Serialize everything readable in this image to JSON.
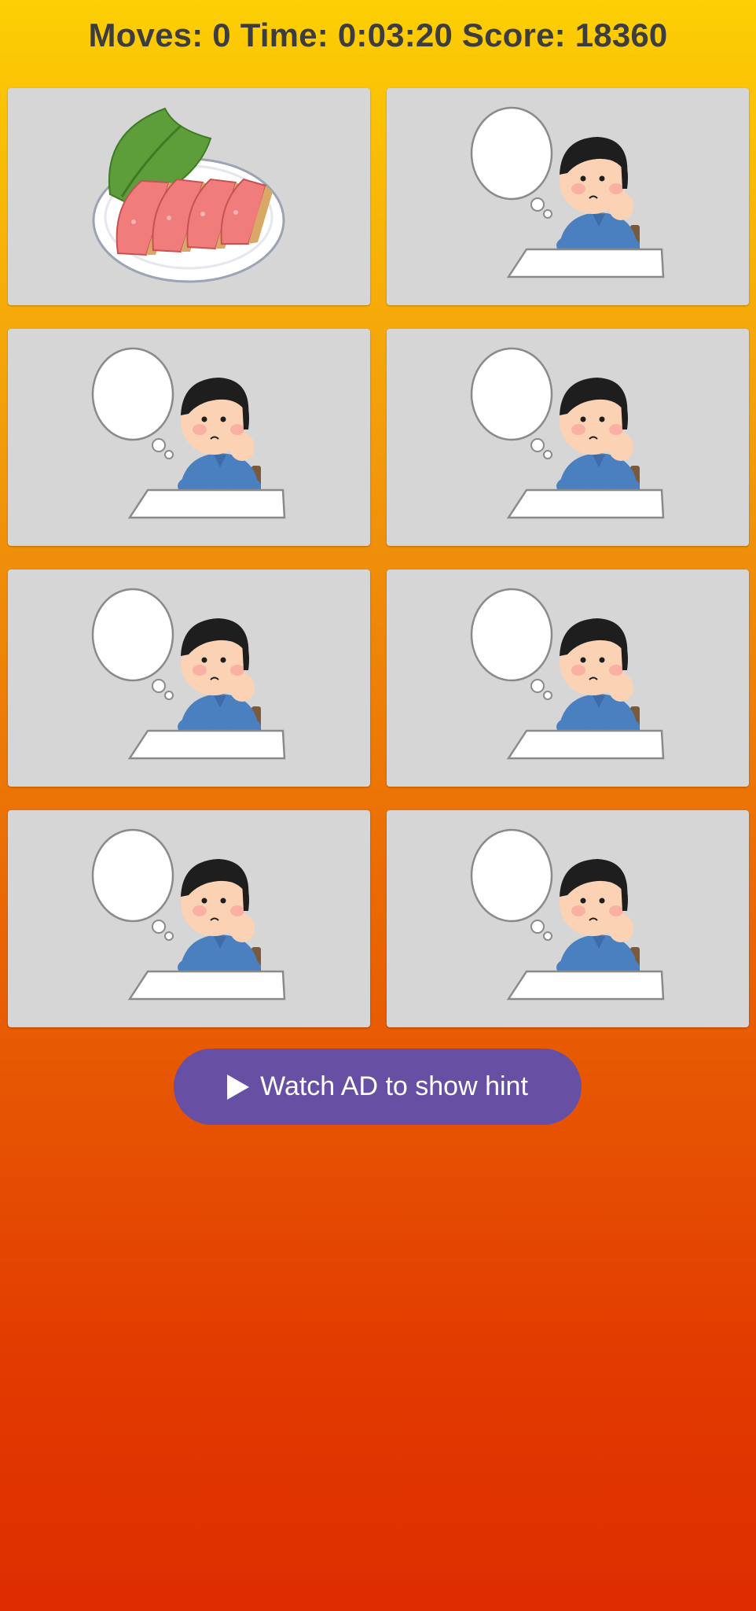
{
  "header": {
    "moves_label": "Moves:",
    "moves_value": "0",
    "time_label": "Time:",
    "time_value": "0:03:20",
    "score_label": "Score:",
    "score_value": "18360"
  },
  "cards": [
    {
      "state": "revealed",
      "image": "sashimi-plate"
    },
    {
      "state": "hidden",
      "image": "thinking-boy"
    },
    {
      "state": "hidden",
      "image": "thinking-boy"
    },
    {
      "state": "hidden",
      "image": "thinking-boy"
    },
    {
      "state": "hidden",
      "image": "thinking-boy"
    },
    {
      "state": "hidden",
      "image": "thinking-boy"
    },
    {
      "state": "hidden",
      "image": "thinking-boy"
    },
    {
      "state": "hidden",
      "image": "thinking-boy"
    }
  ],
  "hint_button": {
    "label": "Watch AD to show hint",
    "icon": "play-icon",
    "color": "#6750A4"
  },
  "colors": {
    "background_top": "#FDCF04",
    "background_bottom": "#DE2D00",
    "card": "#D6D6D6"
  }
}
